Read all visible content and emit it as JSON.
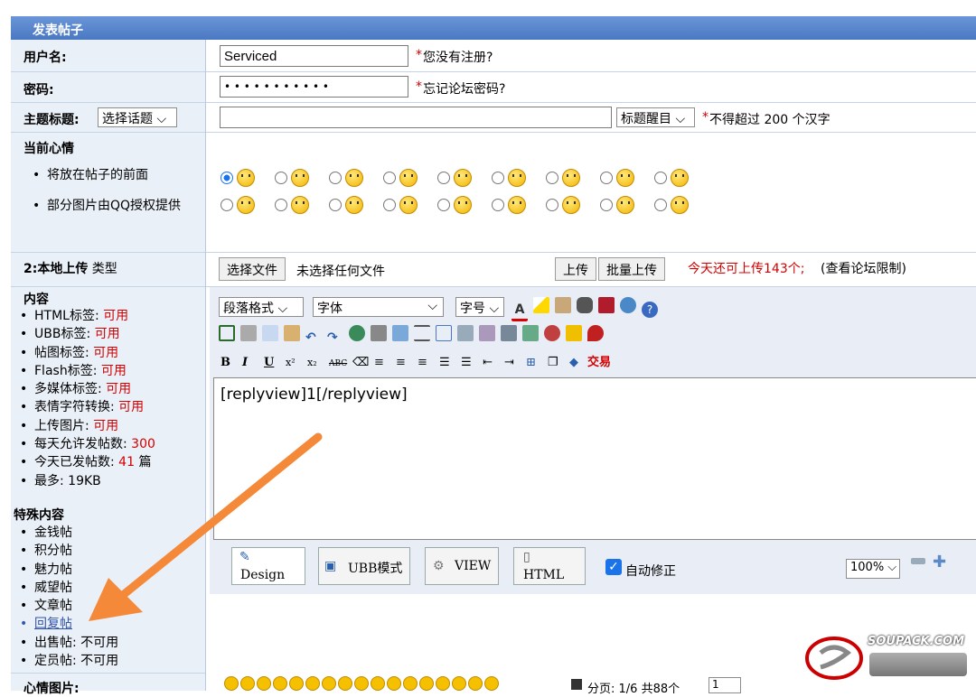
{
  "header": {
    "title": "发表帖子"
  },
  "username": {
    "label": "用户名:",
    "value": "Serviced",
    "note_star": "*",
    "note": "您没有注册?"
  },
  "password": {
    "label": "密码:",
    "value": "• • • • • • • • • • •",
    "note_star": "*",
    "note": "忘记论坛密码?"
  },
  "subject": {
    "label": "主题标题:",
    "topic_select": "选择话题",
    "highlight_select": "标题醒目",
    "note_star": "*",
    "note": "不得超过 200 个汉字"
  },
  "mood": {
    "label": "当前心情",
    "bullet1": "将放在帖子的前面",
    "bullet2": "部分图片由QQ授权提供"
  },
  "upload": {
    "label": "2:本地上传",
    "label_suffix": " 类型",
    "choose": "选择文件",
    "no_file": "未选择任何文件",
    "upload_btn": "上传",
    "batch_btn": "批量上传",
    "remaining": "今天还可上传143个;",
    "limit": "(查看论坛限制)"
  },
  "content": {
    "label": "内容",
    "items": [
      {
        "k": "HTML标签:",
        "v": "可用",
        "red": true
      },
      {
        "k": "UBB标签:",
        "v": "可用",
        "red": true
      },
      {
        "k": "帖图标签:",
        "v": "可用",
        "red": true
      },
      {
        "k": "Flash标签:",
        "v": "可用",
        "red": true
      },
      {
        "k": "多媒体标签:",
        "v": "可用",
        "red": true
      },
      {
        "k": "表情字符转换:",
        "v": "可用",
        "red": true
      },
      {
        "k": "上传图片:",
        "v": "可用",
        "red": true
      },
      {
        "k": "每天允许发帖数:",
        "v": "300",
        "red": true
      },
      {
        "k": "今天已发帖数:",
        "v": "41",
        "v2": " 篇",
        "red": true
      },
      {
        "k": "最多:",
        "v": "19KB",
        "red": false
      }
    ]
  },
  "special": {
    "label": "特殊内容",
    "items": [
      "金钱帖",
      "积分帖",
      "魅力帖",
      "威望帖",
      "文章帖",
      "回复帖"
    ],
    "sale": {
      "k": "出售帖:",
      "v": "不可用"
    },
    "fixed": {
      "k": "定员帖:",
      "v": "不可用"
    }
  },
  "editor": {
    "format_select": "段落格式",
    "font_select": "字体",
    "size_select": "字号",
    "exchange": "交易",
    "body": "[replyview]1[/replyview]",
    "mode_design": "Design",
    "mode_ubb": "UBB模式",
    "mode_view": "VIEW",
    "mode_html": "HTML",
    "autofix": "自动修正",
    "zoom": "100%"
  },
  "mood_image": {
    "label": "心情图片:",
    "paging": "分页: 1/6 共88个",
    "page_select": "1"
  },
  "watermark": {
    "text": "SOUPACK.COM"
  }
}
